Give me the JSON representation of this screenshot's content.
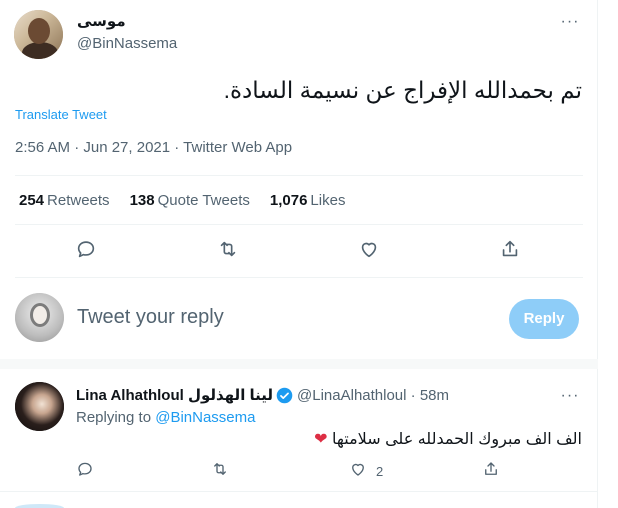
{
  "tweet": {
    "author_name": "موسى",
    "author_handle": "@BinNassema",
    "text": "تم بحمدالله الإفراج عن نسيمة السادة.",
    "translate_label": "Translate Tweet",
    "meta": "2:56 AM · Jun 27, 2021 · Twitter Web App",
    "stats": [
      {
        "count": "254",
        "label": "Retweets"
      },
      {
        "count": "138",
        "label": "Quote Tweets"
      },
      {
        "count": "1,076",
        "label": "Likes"
      }
    ],
    "actions": [
      "reply-icon",
      "retweet-icon",
      "like-icon",
      "share-icon"
    ],
    "more_glyph": "···"
  },
  "composer": {
    "placeholder": "Tweet your reply",
    "button_label": "Reply",
    "button_color": "#8ecdf8"
  },
  "reply": {
    "author_name": "Lina Alhathloul لينا الهذلول",
    "verified": "verified-badge-icon",
    "handle_time": "@LinaAlhathloul · 58m",
    "replying_prefix": "Replying to",
    "replying_to": "@BinNassema",
    "text": "الف الف مبروك الحمدلله على سلامتها",
    "emoji": "❤",
    "like_count": "2",
    "more_glyph": "···"
  },
  "colors": {
    "link": "#1d9bf0",
    "secondary_text": "#536471",
    "primary_text": "#0f1419",
    "verified": "#1d9bf0",
    "heart": "#dd2e44"
  }
}
